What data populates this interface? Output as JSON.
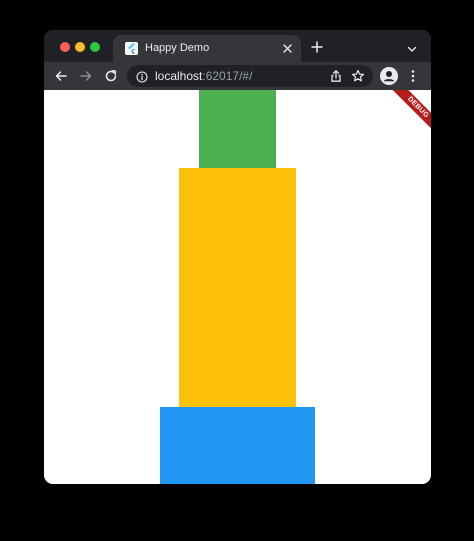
{
  "browser": {
    "tab": {
      "title": "Happy Demo",
      "favicon": "flutter-icon"
    },
    "address_bar": {
      "host": "localhost",
      "rest": ":62017/#/"
    },
    "icons": {
      "back": "arrow-left-icon",
      "forward": "arrow-right-icon",
      "reload": "reload-icon",
      "site_info": "info-icon",
      "share": "share-icon",
      "bookmark": "star-icon",
      "profile": "person-icon",
      "menu": "kebab-menu-icon",
      "new_tab": "plus-icon",
      "tab_search": "chevron-down-icon"
    }
  },
  "app": {
    "debug_banner": "DEBUG",
    "boxes": [
      {
        "name": "green",
        "color": "#4caf50"
      },
      {
        "name": "amber",
        "color": "#ffc107"
      },
      {
        "name": "blue",
        "color": "#2196f3"
      }
    ]
  }
}
